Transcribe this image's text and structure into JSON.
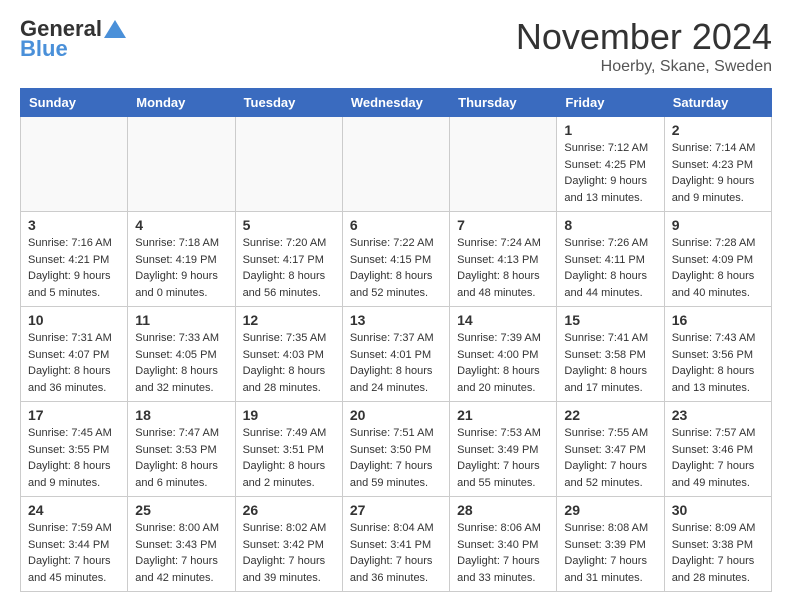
{
  "header": {
    "logo_general": "General",
    "logo_blue": "Blue",
    "month_title": "November 2024",
    "location": "Hoerby, Skane, Sweden"
  },
  "days_of_week": [
    "Sunday",
    "Monday",
    "Tuesday",
    "Wednesday",
    "Thursday",
    "Friday",
    "Saturday"
  ],
  "weeks": [
    [
      {
        "day": "",
        "info": ""
      },
      {
        "day": "",
        "info": ""
      },
      {
        "day": "",
        "info": ""
      },
      {
        "day": "",
        "info": ""
      },
      {
        "day": "",
        "info": ""
      },
      {
        "day": "1",
        "info": "Sunrise: 7:12 AM\nSunset: 4:25 PM\nDaylight: 9 hours and 13 minutes."
      },
      {
        "day": "2",
        "info": "Sunrise: 7:14 AM\nSunset: 4:23 PM\nDaylight: 9 hours and 9 minutes."
      }
    ],
    [
      {
        "day": "3",
        "info": "Sunrise: 7:16 AM\nSunset: 4:21 PM\nDaylight: 9 hours and 5 minutes."
      },
      {
        "day": "4",
        "info": "Sunrise: 7:18 AM\nSunset: 4:19 PM\nDaylight: 9 hours and 0 minutes."
      },
      {
        "day": "5",
        "info": "Sunrise: 7:20 AM\nSunset: 4:17 PM\nDaylight: 8 hours and 56 minutes."
      },
      {
        "day": "6",
        "info": "Sunrise: 7:22 AM\nSunset: 4:15 PM\nDaylight: 8 hours and 52 minutes."
      },
      {
        "day": "7",
        "info": "Sunrise: 7:24 AM\nSunset: 4:13 PM\nDaylight: 8 hours and 48 minutes."
      },
      {
        "day": "8",
        "info": "Sunrise: 7:26 AM\nSunset: 4:11 PM\nDaylight: 8 hours and 44 minutes."
      },
      {
        "day": "9",
        "info": "Sunrise: 7:28 AM\nSunset: 4:09 PM\nDaylight: 8 hours and 40 minutes."
      }
    ],
    [
      {
        "day": "10",
        "info": "Sunrise: 7:31 AM\nSunset: 4:07 PM\nDaylight: 8 hours and 36 minutes."
      },
      {
        "day": "11",
        "info": "Sunrise: 7:33 AM\nSunset: 4:05 PM\nDaylight: 8 hours and 32 minutes."
      },
      {
        "day": "12",
        "info": "Sunrise: 7:35 AM\nSunset: 4:03 PM\nDaylight: 8 hours and 28 minutes."
      },
      {
        "day": "13",
        "info": "Sunrise: 7:37 AM\nSunset: 4:01 PM\nDaylight: 8 hours and 24 minutes."
      },
      {
        "day": "14",
        "info": "Sunrise: 7:39 AM\nSunset: 4:00 PM\nDaylight: 8 hours and 20 minutes."
      },
      {
        "day": "15",
        "info": "Sunrise: 7:41 AM\nSunset: 3:58 PM\nDaylight: 8 hours and 17 minutes."
      },
      {
        "day": "16",
        "info": "Sunrise: 7:43 AM\nSunset: 3:56 PM\nDaylight: 8 hours and 13 minutes."
      }
    ],
    [
      {
        "day": "17",
        "info": "Sunrise: 7:45 AM\nSunset: 3:55 PM\nDaylight: 8 hours and 9 minutes."
      },
      {
        "day": "18",
        "info": "Sunrise: 7:47 AM\nSunset: 3:53 PM\nDaylight: 8 hours and 6 minutes."
      },
      {
        "day": "19",
        "info": "Sunrise: 7:49 AM\nSunset: 3:51 PM\nDaylight: 8 hours and 2 minutes."
      },
      {
        "day": "20",
        "info": "Sunrise: 7:51 AM\nSunset: 3:50 PM\nDaylight: 7 hours and 59 minutes."
      },
      {
        "day": "21",
        "info": "Sunrise: 7:53 AM\nSunset: 3:49 PM\nDaylight: 7 hours and 55 minutes."
      },
      {
        "day": "22",
        "info": "Sunrise: 7:55 AM\nSunset: 3:47 PM\nDaylight: 7 hours and 52 minutes."
      },
      {
        "day": "23",
        "info": "Sunrise: 7:57 AM\nSunset: 3:46 PM\nDaylight: 7 hours and 49 minutes."
      }
    ],
    [
      {
        "day": "24",
        "info": "Sunrise: 7:59 AM\nSunset: 3:44 PM\nDaylight: 7 hours and 45 minutes."
      },
      {
        "day": "25",
        "info": "Sunrise: 8:00 AM\nSunset: 3:43 PM\nDaylight: 7 hours and 42 minutes."
      },
      {
        "day": "26",
        "info": "Sunrise: 8:02 AM\nSunset: 3:42 PM\nDaylight: 7 hours and 39 minutes."
      },
      {
        "day": "27",
        "info": "Sunrise: 8:04 AM\nSunset: 3:41 PM\nDaylight: 7 hours and 36 minutes."
      },
      {
        "day": "28",
        "info": "Sunrise: 8:06 AM\nSunset: 3:40 PM\nDaylight: 7 hours and 33 minutes."
      },
      {
        "day": "29",
        "info": "Sunrise: 8:08 AM\nSunset: 3:39 PM\nDaylight: 7 hours and 31 minutes."
      },
      {
        "day": "30",
        "info": "Sunrise: 8:09 AM\nSunset: 3:38 PM\nDaylight: 7 hours and 28 minutes."
      }
    ]
  ]
}
